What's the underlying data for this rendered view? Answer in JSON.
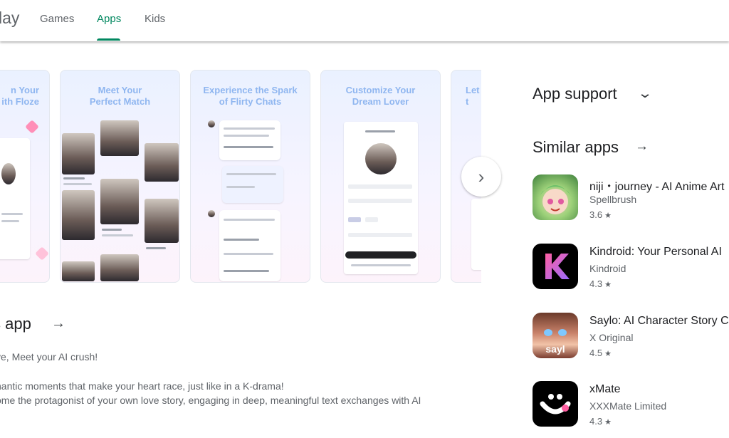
{
  "header": {
    "logo_partial": "lay",
    "tabs": [
      {
        "label": "Games",
        "active": false
      },
      {
        "label": "Apps",
        "active": true
      },
      {
        "label": "Kids",
        "active": false
      }
    ],
    "accent_color": "#01875f"
  },
  "screenshots": {
    "captions": [
      "n Your\nith Floze",
      "Meet Your\nPerfect Match",
      "Experience the Spark\nof Flirty Chats",
      "Customize Your\nDream Lover",
      "Let\nt"
    ],
    "next_icon": "chevron-right-icon"
  },
  "about": {
    "title": "s app",
    "lines": [
      "ve, Meet your AI crush!",
      "nantic moments that make your heart race, just like in a K-drama!",
      "ome the protagonist of your own love story, engaging in deep, meaningful text exchanges with AI"
    ]
  },
  "app_support": {
    "title": "App support",
    "icon": "chevron-down-icon"
  },
  "similar_apps": {
    "title": "Similar apps",
    "icon": "arrow-right-icon",
    "items": [
      {
        "name": "niji・journey - AI Anime Art",
        "developer": "Spellbrush",
        "rating": "3.6"
      },
      {
        "name": "Kindroid: Your Personal AI",
        "developer": "Kindroid",
        "rating": "4.3"
      },
      {
        "name": "Saylo: AI Character Story Ch",
        "developer": "X Original",
        "rating": "4.5"
      },
      {
        "name": "xMate",
        "developer": "XXXMate Limited",
        "rating": "4.3"
      }
    ]
  }
}
